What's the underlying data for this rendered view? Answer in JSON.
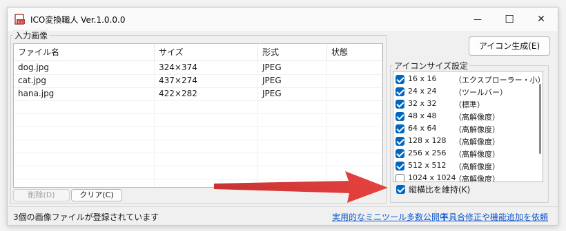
{
  "window": {
    "title": "ICO変換職人 Ver.1.0.0.0",
    "controls": {
      "minimize": "—",
      "maximize": "☐",
      "close": "✕"
    }
  },
  "input_group": {
    "label": "入力画像",
    "columns": [
      "ファイル名",
      "サイズ",
      "形式",
      "状態"
    ],
    "rows": [
      {
        "name": "dog.jpg",
        "size": "324×374",
        "format": "JPEG",
        "status": ""
      },
      {
        "name": "cat.jpg",
        "size": "437×274",
        "format": "JPEG",
        "status": ""
      },
      {
        "name": "hana.jpg",
        "size": "422×282",
        "format": "JPEG",
        "status": ""
      }
    ]
  },
  "buttons": {
    "delete": "削除(D)",
    "clear": "クリア(C)",
    "generate": "アイコン生成(E)"
  },
  "icon_sizes": {
    "label": "アイコンサイズ設定",
    "items": [
      {
        "size": "16 x 16",
        "desc": "（エクスプローラー・小）",
        "checked": true
      },
      {
        "size": "24 x 24",
        "desc": "（ツールバー）",
        "checked": true
      },
      {
        "size": "32 x 32",
        "desc": "（標準）",
        "checked": true
      },
      {
        "size": "48 x 48",
        "desc": "（高解像度）",
        "checked": true
      },
      {
        "size": "64 x 64",
        "desc": "（高解像度）",
        "checked": true
      },
      {
        "size": "128 x 128",
        "desc": "（高解像度）",
        "checked": true
      },
      {
        "size": "256 x 256",
        "desc": "（高解像度）",
        "checked": true
      },
      {
        "size": "512 x 512",
        "desc": "（高解像度）",
        "checked": true
      },
      {
        "size": "1024 x 1024",
        "desc": "（高解像度）",
        "checked": false
      }
    ],
    "keep_aspect_label": "縦横比を維持(K)",
    "keep_aspect_checked": true
  },
  "status": {
    "message": "3個の画像ファイルが登録されています",
    "link1": "実用的なミニツール多数公開中",
    "link2": "不具合修正や機能追加を依頼"
  },
  "colors": {
    "accent": "#0067c0",
    "arrow": "#d42a2a",
    "link": "#0b57d0"
  }
}
